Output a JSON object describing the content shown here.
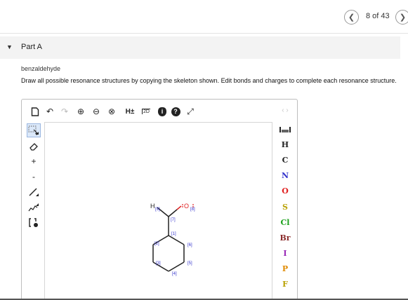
{
  "pager": {
    "text": "8 of 43",
    "prev_icon": "chevron-left-icon",
    "next_icon": "chevron-right-icon"
  },
  "part": {
    "title": "Part A"
  },
  "question": {
    "subject": "benzaldehyde",
    "instructions": "Draw all possible resonance structures by copying the skeleton shown. Edit bonds and charges to complete each resonance structure."
  },
  "toolbar": {
    "redo_glyph": "↷",
    "undo_glyph": "↶",
    "zoom_in_glyph": "⊕",
    "zoom_out_glyph": "⊖",
    "zoom_reset_glyph": "⊗",
    "h_toggle": "H±",
    "clean_2d": "2D",
    "info_glyph": "i",
    "help_glyph": "?",
    "fullscreen_glyph": "⤢"
  },
  "left_tools": {
    "plus": "+",
    "minus": "-"
  },
  "elements": [
    "H",
    "C",
    "N",
    "O",
    "S",
    "Cl",
    "Br",
    "I",
    "P",
    "F"
  ],
  "element_colors": {
    "H": "#222222",
    "C": "#222222",
    "N": "#3333cc",
    "O": "#e02020",
    "S": "#b8a000",
    "Cl": "#1aa01a",
    "Br": "#8a2a2a",
    "I": "#9a2ab8",
    "P": "#e08a00",
    "F": "#b8a000"
  },
  "molecule": {
    "h_label": "H",
    "o_label": "O",
    "atom_maps": [
      "[1]",
      "[2]",
      "[3]",
      "[4]",
      "[5]",
      "[6]",
      "[7]",
      "[8]",
      "[9]"
    ],
    "map_color": "#3333cc",
    "oxygen_color": "#e02020"
  },
  "periodic_table_label": "periodic-table",
  "nav_arrows": "‹ ›"
}
